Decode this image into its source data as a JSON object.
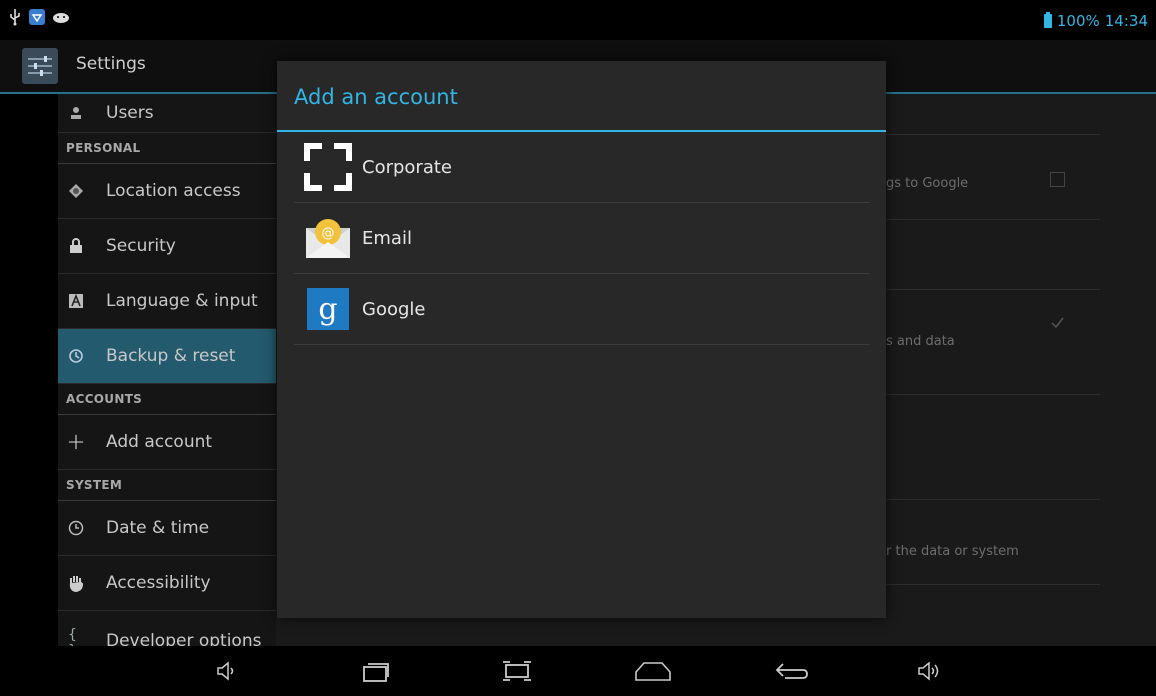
{
  "status_bar": {
    "battery": "100%",
    "time": "14:34",
    "icons": [
      "usb-icon",
      "shield-notification-icon",
      "android-debug-icon",
      "battery-icon"
    ]
  },
  "action_bar": {
    "title": "Settings"
  },
  "settings_list": {
    "items": [
      {
        "label": "Users",
        "icon": "users-icon"
      },
      {
        "header": "PERSONAL"
      },
      {
        "label": "Location access",
        "icon": "location-icon"
      },
      {
        "label": "Security",
        "icon": "lock-icon"
      },
      {
        "label": "Language & input",
        "icon": "language-icon"
      },
      {
        "label": "Backup & reset",
        "icon": "backup-icon",
        "selected": true
      },
      {
        "header": "ACCOUNTS"
      },
      {
        "label": "Add account",
        "icon": "plus-icon"
      },
      {
        "header": "SYSTEM"
      },
      {
        "label": "Date & time",
        "icon": "clock-icon"
      },
      {
        "label": "Accessibility",
        "icon": "hand-icon"
      },
      {
        "label": "Developer options",
        "icon": "braces-icon"
      }
    ]
  },
  "detail_panel": {
    "partial_texts": [
      "gs to Google",
      "s and data",
      "r the data or system"
    ]
  },
  "dialog": {
    "title": "Add an account",
    "accounts": [
      {
        "label": "Corporate",
        "icon": "corporate-icon"
      },
      {
        "label": "Email",
        "icon": "email-icon"
      },
      {
        "label": "Google",
        "icon": "google-icon"
      }
    ]
  },
  "nav_bar": {
    "buttons": [
      "volume-down-icon",
      "recent-apps-icon",
      "screenshot-icon",
      "home-icon",
      "back-icon",
      "volume-up-icon"
    ]
  },
  "colors": {
    "accent": "#33b5e5",
    "selected_item": "#245a6e",
    "dialog_bg": "#282828"
  }
}
